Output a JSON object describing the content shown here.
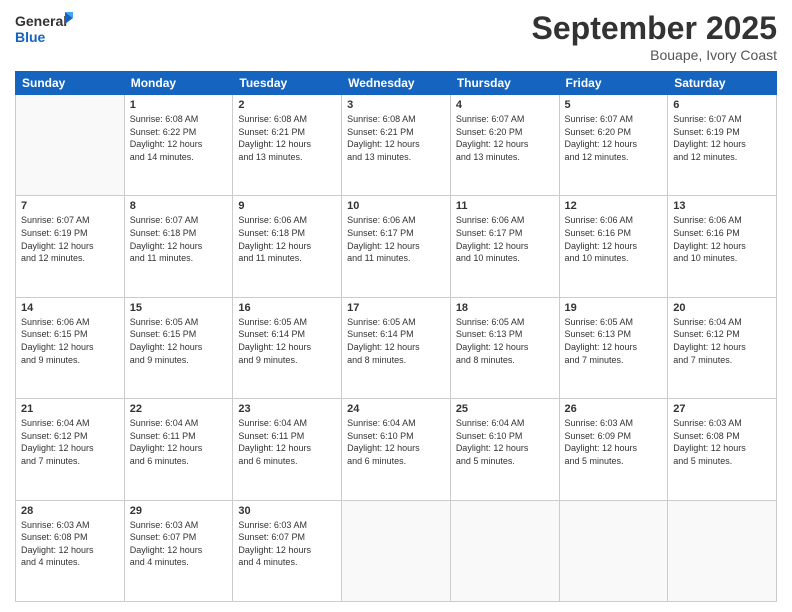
{
  "header": {
    "logo_line1": "General",
    "logo_line2": "Blue",
    "month": "September 2025",
    "location": "Bouape, Ivory Coast"
  },
  "weekdays": [
    "Sunday",
    "Monday",
    "Tuesday",
    "Wednesday",
    "Thursday",
    "Friday",
    "Saturday"
  ],
  "weeks": [
    [
      {
        "day": "",
        "info": ""
      },
      {
        "day": "1",
        "info": "Sunrise: 6:08 AM\nSunset: 6:22 PM\nDaylight: 12 hours\nand 14 minutes."
      },
      {
        "day": "2",
        "info": "Sunrise: 6:08 AM\nSunset: 6:21 PM\nDaylight: 12 hours\nand 13 minutes."
      },
      {
        "day": "3",
        "info": "Sunrise: 6:08 AM\nSunset: 6:21 PM\nDaylight: 12 hours\nand 13 minutes."
      },
      {
        "day": "4",
        "info": "Sunrise: 6:07 AM\nSunset: 6:20 PM\nDaylight: 12 hours\nand 13 minutes."
      },
      {
        "day": "5",
        "info": "Sunrise: 6:07 AM\nSunset: 6:20 PM\nDaylight: 12 hours\nand 12 minutes."
      },
      {
        "day": "6",
        "info": "Sunrise: 6:07 AM\nSunset: 6:19 PM\nDaylight: 12 hours\nand 12 minutes."
      }
    ],
    [
      {
        "day": "7",
        "info": "Sunrise: 6:07 AM\nSunset: 6:19 PM\nDaylight: 12 hours\nand 12 minutes."
      },
      {
        "day": "8",
        "info": "Sunrise: 6:07 AM\nSunset: 6:18 PM\nDaylight: 12 hours\nand 11 minutes."
      },
      {
        "day": "9",
        "info": "Sunrise: 6:06 AM\nSunset: 6:18 PM\nDaylight: 12 hours\nand 11 minutes."
      },
      {
        "day": "10",
        "info": "Sunrise: 6:06 AM\nSunset: 6:17 PM\nDaylight: 12 hours\nand 11 minutes."
      },
      {
        "day": "11",
        "info": "Sunrise: 6:06 AM\nSunset: 6:17 PM\nDaylight: 12 hours\nand 10 minutes."
      },
      {
        "day": "12",
        "info": "Sunrise: 6:06 AM\nSunset: 6:16 PM\nDaylight: 12 hours\nand 10 minutes."
      },
      {
        "day": "13",
        "info": "Sunrise: 6:06 AM\nSunset: 6:16 PM\nDaylight: 12 hours\nand 10 minutes."
      }
    ],
    [
      {
        "day": "14",
        "info": "Sunrise: 6:06 AM\nSunset: 6:15 PM\nDaylight: 12 hours\nand 9 minutes."
      },
      {
        "day": "15",
        "info": "Sunrise: 6:05 AM\nSunset: 6:15 PM\nDaylight: 12 hours\nand 9 minutes."
      },
      {
        "day": "16",
        "info": "Sunrise: 6:05 AM\nSunset: 6:14 PM\nDaylight: 12 hours\nand 9 minutes."
      },
      {
        "day": "17",
        "info": "Sunrise: 6:05 AM\nSunset: 6:14 PM\nDaylight: 12 hours\nand 8 minutes."
      },
      {
        "day": "18",
        "info": "Sunrise: 6:05 AM\nSunset: 6:13 PM\nDaylight: 12 hours\nand 8 minutes."
      },
      {
        "day": "19",
        "info": "Sunrise: 6:05 AM\nSunset: 6:13 PM\nDaylight: 12 hours\nand 7 minutes."
      },
      {
        "day": "20",
        "info": "Sunrise: 6:04 AM\nSunset: 6:12 PM\nDaylight: 12 hours\nand 7 minutes."
      }
    ],
    [
      {
        "day": "21",
        "info": "Sunrise: 6:04 AM\nSunset: 6:12 PM\nDaylight: 12 hours\nand 7 minutes."
      },
      {
        "day": "22",
        "info": "Sunrise: 6:04 AM\nSunset: 6:11 PM\nDaylight: 12 hours\nand 6 minutes."
      },
      {
        "day": "23",
        "info": "Sunrise: 6:04 AM\nSunset: 6:11 PM\nDaylight: 12 hours\nand 6 minutes."
      },
      {
        "day": "24",
        "info": "Sunrise: 6:04 AM\nSunset: 6:10 PM\nDaylight: 12 hours\nand 6 minutes."
      },
      {
        "day": "25",
        "info": "Sunrise: 6:04 AM\nSunset: 6:10 PM\nDaylight: 12 hours\nand 5 minutes."
      },
      {
        "day": "26",
        "info": "Sunrise: 6:03 AM\nSunset: 6:09 PM\nDaylight: 12 hours\nand 5 minutes."
      },
      {
        "day": "27",
        "info": "Sunrise: 6:03 AM\nSunset: 6:08 PM\nDaylight: 12 hours\nand 5 minutes."
      }
    ],
    [
      {
        "day": "28",
        "info": "Sunrise: 6:03 AM\nSunset: 6:08 PM\nDaylight: 12 hours\nand 4 minutes."
      },
      {
        "day": "29",
        "info": "Sunrise: 6:03 AM\nSunset: 6:07 PM\nDaylight: 12 hours\nand 4 minutes."
      },
      {
        "day": "30",
        "info": "Sunrise: 6:03 AM\nSunset: 6:07 PM\nDaylight: 12 hours\nand 4 minutes."
      },
      {
        "day": "",
        "info": ""
      },
      {
        "day": "",
        "info": ""
      },
      {
        "day": "",
        "info": ""
      },
      {
        "day": "",
        "info": ""
      }
    ]
  ]
}
